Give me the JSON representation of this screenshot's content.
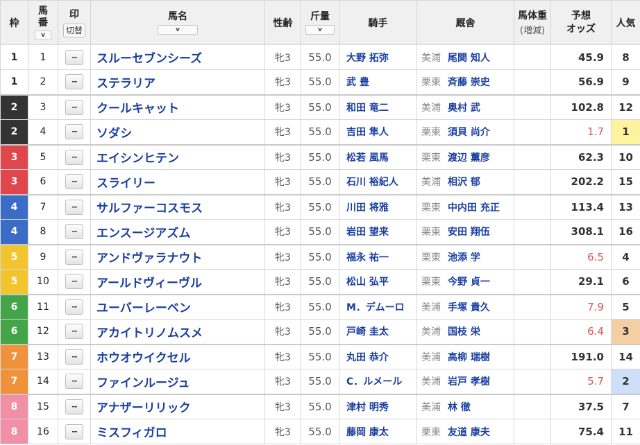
{
  "headers": {
    "waku": "枠",
    "umaban": "馬番",
    "mark": "印",
    "mark_toggle": "切替",
    "horse": "馬名",
    "seirei": "性齢",
    "kinryo": "斤量",
    "jockey": "騎手",
    "stable": "厩舎",
    "weight": "馬体重",
    "weight_sub": "(増減)",
    "odds": "予想オッズ",
    "odds_line1": "予想",
    "odds_line2": "オッズ",
    "ninki": "人気",
    "sort_icon": "v"
  },
  "mark_placeholder": "--",
  "waku_colors": {
    "1": {
      "bg": "#ffffff",
      "fg": "#222222"
    },
    "2": {
      "bg": "#333333",
      "fg": "#ffffff"
    },
    "3": {
      "bg": "#e0474c",
      "fg": "#ffffff"
    },
    "4": {
      "bg": "#3b6cc6",
      "fg": "#ffffff"
    },
    "5": {
      "bg": "#f2c52e",
      "fg": "#ffffff"
    },
    "6": {
      "bg": "#43a548",
      "fg": "#ffffff"
    },
    "7": {
      "bg": "#f0923b",
      "fg": "#ffffff"
    },
    "8": {
      "bg": "#f08fa6",
      "fg": "#ffffff"
    }
  },
  "ninki_highlight": {
    "1": "#fff3a0",
    "2": "#cde0f7",
    "3": "#f4cfa5"
  },
  "rows": [
    {
      "waku": "1",
      "umaban": "1",
      "horse": "スルーセブンシーズ",
      "seirei": "牝3",
      "kinryo": "55.0",
      "jockey": "大野 拓弥",
      "region": "美浦",
      "trainer": "尾関 知人",
      "weight": "",
      "odds": "45.9",
      "ninki": "8"
    },
    {
      "waku": "1",
      "umaban": "2",
      "horse": "ステラリア",
      "seirei": "牝3",
      "kinryo": "55.0",
      "jockey": "武 豊",
      "region": "栗東",
      "trainer": "斉藤 崇史",
      "weight": "",
      "odds": "56.9",
      "ninki": "9"
    },
    {
      "waku": "2",
      "umaban": "3",
      "horse": "クールキャット",
      "seirei": "牝3",
      "kinryo": "55.0",
      "jockey": "和田 竜二",
      "region": "美浦",
      "trainer": "奥村 武",
      "weight": "",
      "odds": "102.8",
      "ninki": "12"
    },
    {
      "waku": "2",
      "umaban": "4",
      "horse": "ソダシ",
      "seirei": "牝3",
      "kinryo": "55.0",
      "jockey": "吉田 隼人",
      "region": "栗東",
      "trainer": "須貝 尚介",
      "weight": "",
      "odds": "1.7",
      "ninki": "1"
    },
    {
      "waku": "3",
      "umaban": "5",
      "horse": "エイシンヒテン",
      "seirei": "牝3",
      "kinryo": "55.0",
      "jockey": "松若 風馬",
      "region": "栗東",
      "trainer": "渡辺 薫彦",
      "weight": "",
      "odds": "62.3",
      "ninki": "10"
    },
    {
      "waku": "3",
      "umaban": "6",
      "horse": "スライリー",
      "seirei": "牝3",
      "kinryo": "55.0",
      "jockey": "石川 裕紀人",
      "region": "美浦",
      "trainer": "相沢 郁",
      "weight": "",
      "odds": "202.2",
      "ninki": "15"
    },
    {
      "waku": "4",
      "umaban": "7",
      "horse": "サルファーコスモス",
      "seirei": "牝3",
      "kinryo": "55.0",
      "jockey": "川田 将雅",
      "region": "栗東",
      "trainer": "中内田 充正",
      "weight": "",
      "odds": "113.4",
      "ninki": "13"
    },
    {
      "waku": "4",
      "umaban": "8",
      "horse": "エンスージアズム",
      "seirei": "牝3",
      "kinryo": "55.0",
      "jockey": "岩田 望来",
      "region": "栗東",
      "trainer": "安田 翔伍",
      "weight": "",
      "odds": "308.1",
      "ninki": "16"
    },
    {
      "waku": "5",
      "umaban": "9",
      "horse": "アンドヴァラナウト",
      "seirei": "牝3",
      "kinryo": "55.0",
      "jockey": "福永 祐一",
      "region": "栗東",
      "trainer": "池添 学",
      "weight": "",
      "odds": "6.5",
      "ninki": "4"
    },
    {
      "waku": "5",
      "umaban": "10",
      "horse": "アールドヴィーヴル",
      "seirei": "牝3",
      "kinryo": "55.0",
      "jockey": "松山 弘平",
      "region": "栗東",
      "trainer": "今野 貞一",
      "weight": "",
      "odds": "29.1",
      "ninki": "6"
    },
    {
      "waku": "6",
      "umaban": "11",
      "horse": "ユーバーレーベン",
      "seirei": "牝3",
      "kinryo": "55.0",
      "jockey": "M．デムーロ",
      "region": "美浦",
      "trainer": "手塚 貴久",
      "weight": "",
      "odds": "7.9",
      "ninki": "5"
    },
    {
      "waku": "6",
      "umaban": "12",
      "horse": "アカイトリノムスメ",
      "seirei": "牝3",
      "kinryo": "55.0",
      "jockey": "戸崎 圭太",
      "region": "美浦",
      "trainer": "国枝 栄",
      "weight": "",
      "odds": "6.4",
      "ninki": "3"
    },
    {
      "waku": "7",
      "umaban": "13",
      "horse": "ホウオウイクセル",
      "seirei": "牝3",
      "kinryo": "55.0",
      "jockey": "丸田 恭介",
      "region": "美浦",
      "trainer": "高柳 瑞樹",
      "weight": "",
      "odds": "191.0",
      "ninki": "14"
    },
    {
      "waku": "7",
      "umaban": "14",
      "horse": "ファインルージュ",
      "seirei": "牝3",
      "kinryo": "55.0",
      "jockey": "C．ルメール",
      "region": "美浦",
      "trainer": "岩戸 孝樹",
      "weight": "",
      "odds": "5.7",
      "ninki": "2"
    },
    {
      "waku": "8",
      "umaban": "15",
      "horse": "アナザーリリック",
      "seirei": "牝3",
      "kinryo": "55.0",
      "jockey": "津村 明秀",
      "region": "美浦",
      "trainer": "林 徹",
      "weight": "",
      "odds": "37.5",
      "ninki": "7"
    },
    {
      "waku": "8",
      "umaban": "16",
      "horse": "ミスフィガロ",
      "seirei": "牝3",
      "kinryo": "55.0",
      "jockey": "藤岡 康太",
      "region": "栗東",
      "trainer": "友道 康夫",
      "weight": "",
      "odds": "75.4",
      "ninki": "11"
    }
  ]
}
